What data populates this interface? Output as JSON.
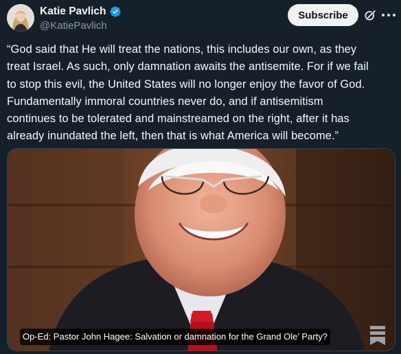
{
  "author": {
    "display_name": "Katie Pavlich",
    "handle": "@KatiePavlich",
    "verified": true,
    "avatar_icon": "avatar-photo"
  },
  "actions": {
    "subscribe_label": "Subscribe",
    "grok_icon": "grok-icon",
    "more_icon": "more-options-icon"
  },
  "tweet": {
    "lines": [
      "“God said that He will treat the nations, this includes our own, as they",
      "treat Israel. As such, only damnation awaits the antisemite. For if we fail",
      "to stop this evil, the United States will no longer enjoy the favor of God.",
      "Fundamentally immoral countries never do, and if antisemitism",
      "continues to be tolerated and mainstreamed on the right, after it has",
      "already inundated the left, then that is what America will become.”"
    ]
  },
  "media": {
    "caption": "Op-Ed: Pastor John Hagee: Salvation or damnation for the Grand Ole’ Party?",
    "bookmark_icon": "bookmark-icon"
  },
  "colors": {
    "background": "#15202b",
    "text": "#f7f9f9",
    "muted": "#8b98a5",
    "verified_blue": "#1d9bf0",
    "button_bg": "#eff3f4"
  }
}
